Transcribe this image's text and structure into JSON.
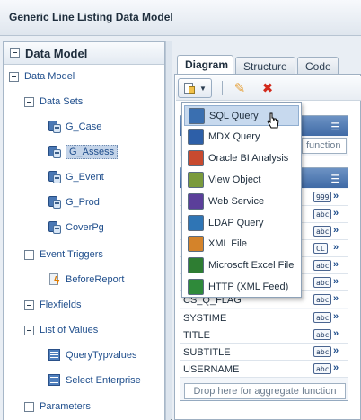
{
  "title": "Generic Line Listing Data Model",
  "left_panel": {
    "header": "Data Model",
    "root": "Data Model",
    "data_sets_label": "Data Sets",
    "data_sets": [
      "G_Case",
      "G_Assess",
      "G_Event",
      "G_Prod",
      "CoverPg"
    ],
    "selected_data_set": "G_Assess",
    "event_triggers_label": "Event Triggers",
    "event_triggers": [
      "BeforeReport"
    ],
    "flexfields_label": "Flexfields",
    "lov_label": "List of Values",
    "lovs": [
      "QueryTypvalues",
      "Select Enterprise"
    ],
    "parameters_label": "Parameters"
  },
  "tabs": [
    "Diagram",
    "Structure",
    "Code"
  ],
  "active_tab": "Diagram",
  "toolbar": {
    "new_data_set_icon": "new-data-set-icon",
    "edit_icon": "pencil-icon",
    "delete_icon": "red-x-icon"
  },
  "menu": {
    "items": [
      {
        "label": "SQL Query",
        "icon": "sql-query-icon",
        "color": "#3a6fb0"
      },
      {
        "label": "MDX Query",
        "icon": "mdx-query-icon",
        "color": "#2d5fa8"
      },
      {
        "label": "Oracle BI Analysis",
        "icon": "oracle-bi-icon",
        "color": "#c84a2f"
      },
      {
        "label": "View Object",
        "icon": "view-object-icon",
        "color": "#7a9a3c"
      },
      {
        "label": "Web Service",
        "icon": "web-service-icon",
        "color": "#5b3f9a"
      },
      {
        "label": "LDAP Query",
        "icon": "ldap-query-icon",
        "color": "#2f75b5"
      },
      {
        "label": "XML File",
        "icon": "xml-file-icon",
        "color": "#d4832a"
      },
      {
        "label": "Microsoft Excel File",
        "icon": "excel-file-icon",
        "color": "#2e7d32"
      },
      {
        "label": "HTTP (XML Feed)",
        "icon": "http-xml-feed-icon",
        "color": "#2f8a3a"
      }
    ],
    "hovered_index": 0
  },
  "background_boxes": {
    "search_placeholder_fragment": "function",
    "rows": [
      {
        "name": "",
        "type": "999"
      },
      {
        "name": "",
        "type": "abc"
      },
      {
        "name": "",
        "type": "abc"
      },
      {
        "name": "",
        "type": "CL"
      },
      {
        "name": "",
        "type": "abc"
      },
      {
        "name": "",
        "type": "abc"
      },
      {
        "name": "CS_Q_FLAG",
        "type": "abc"
      },
      {
        "name": "SYSTIME",
        "type": "abc"
      },
      {
        "name": "TITLE",
        "type": "abc"
      },
      {
        "name": "SUBTITLE",
        "type": "abc"
      },
      {
        "name": "USERNAME",
        "type": "abc"
      }
    ],
    "aggregate_placeholder": "Drop here for aggregate function"
  }
}
